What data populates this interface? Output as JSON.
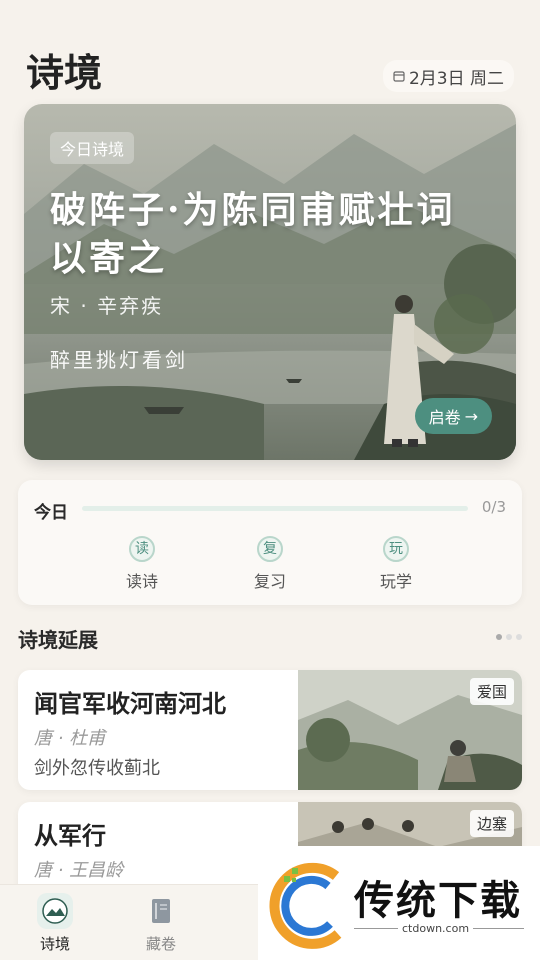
{
  "header": {
    "title": "诗境",
    "date": "2月3日 周二"
  },
  "hero": {
    "tag": "今日诗境",
    "title": "破阵子·为陈同甫赋壮词以寄之",
    "author": "宋 · 辛弃疾",
    "line": "醉里挑灯看剑",
    "button": "启卷"
  },
  "today": {
    "label": "今日",
    "progress_text": "0/3",
    "progress": 0,
    "tasks": [
      {
        "badge": "读",
        "label": "读诗"
      },
      {
        "badge": "复",
        "label": "复习"
      },
      {
        "badge": "玩",
        "label": "玩学"
      }
    ]
  },
  "section": {
    "title": "诗境延展"
  },
  "poems": [
    {
      "title": "闻官军收河南河北",
      "author": "唐 · 杜甫",
      "line": "剑外忽传收蓟北",
      "tag": "爱国"
    },
    {
      "title": "从军行",
      "author": "唐 · 王昌龄",
      "line": "",
      "tag": "边塞"
    }
  ],
  "nav": [
    {
      "label": "诗境",
      "icon": "landscape-icon"
    },
    {
      "label": "藏卷",
      "icon": "book-icon"
    }
  ],
  "watermark": {
    "text": "传统下载",
    "url": "ctdown.com"
  },
  "colors": {
    "accent": "#4d8f80",
    "background": "#f6f2ec"
  }
}
